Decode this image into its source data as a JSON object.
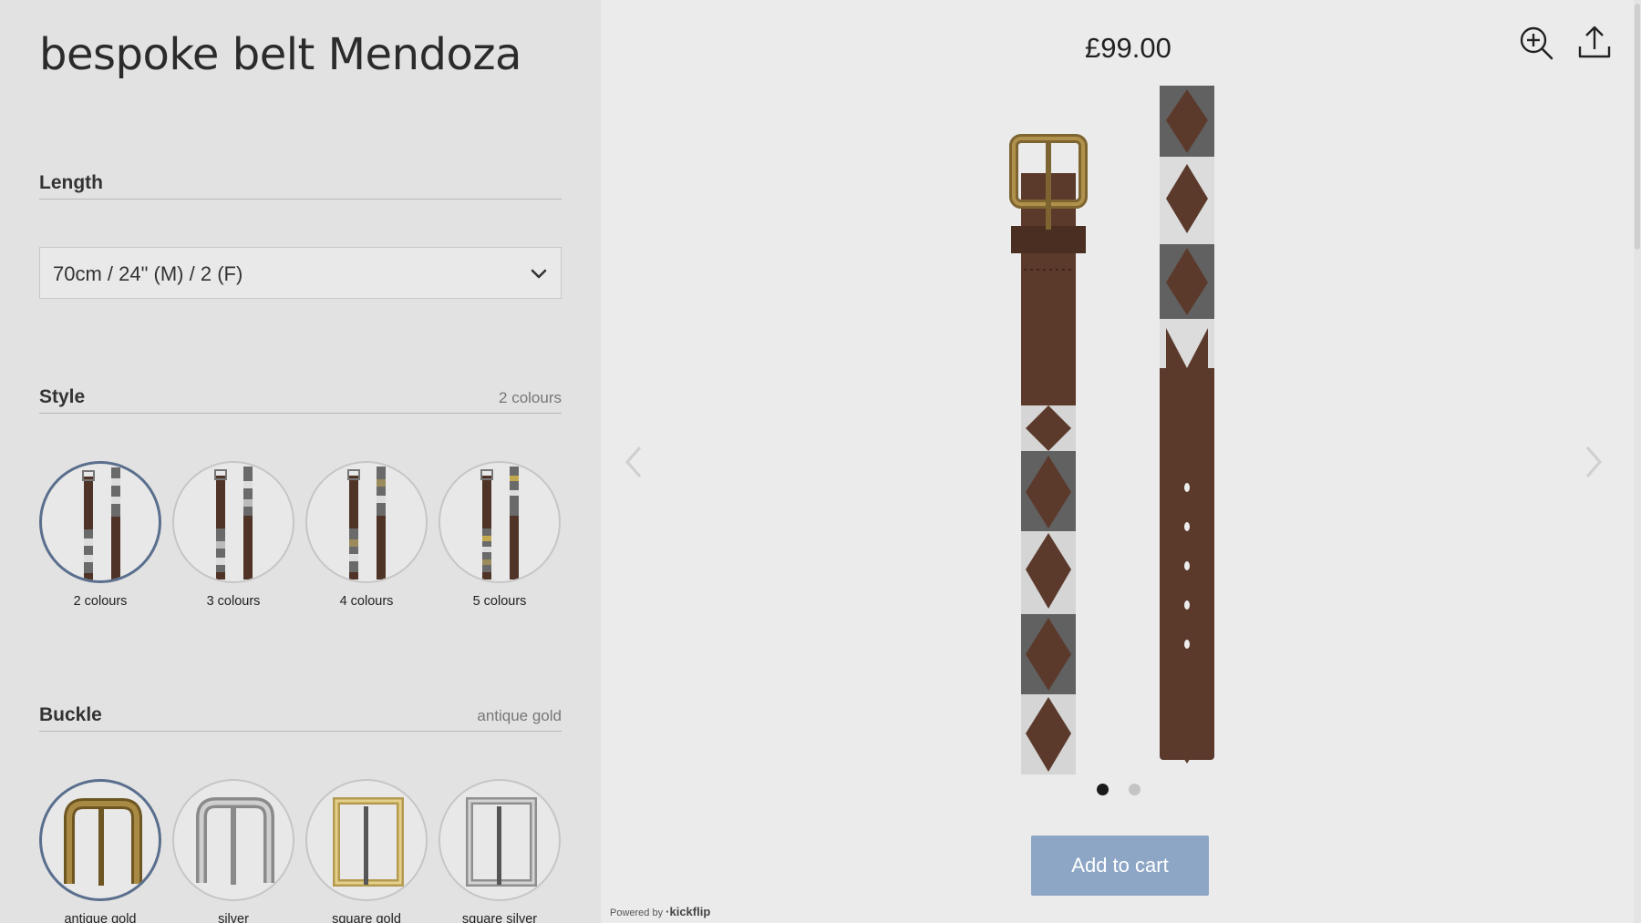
{
  "product": {
    "title": "bespoke belt Mendoza",
    "price": "£99.00"
  },
  "length": {
    "label": "Length",
    "selected": "70cm / 24\" (M) / 2 (F)"
  },
  "style": {
    "label": "Style",
    "value": "2 colours",
    "options": [
      {
        "label": "2 colours",
        "selected": true
      },
      {
        "label": "3 colours",
        "selected": false
      },
      {
        "label": "4 colours",
        "selected": false
      },
      {
        "label": "5 colours",
        "selected": false
      }
    ]
  },
  "buckle": {
    "label": "Buckle",
    "value": "antique gold",
    "options": [
      {
        "label": "antique gold",
        "selected": true
      },
      {
        "label": "silver",
        "selected": false
      },
      {
        "label": "square gold",
        "selected": false
      },
      {
        "label": "square silver",
        "selected": false
      }
    ]
  },
  "preview": {
    "page_count": 2,
    "active_page": 1
  },
  "actions": {
    "add_to_cart": "Add to cart",
    "zoom_icon": "zoom-in-icon",
    "share_icon": "share-upload-icon"
  },
  "footer": {
    "powered_prefix": "Powered by",
    "powered_brand": "·kickflip"
  },
  "colors": {
    "accent": "#8da6c5",
    "selected_ring": "#5a6f8d",
    "leather": "#5b3a2c",
    "stitch_grey": "#5e5e5e",
    "stitch_white": "#d8d8d8"
  }
}
